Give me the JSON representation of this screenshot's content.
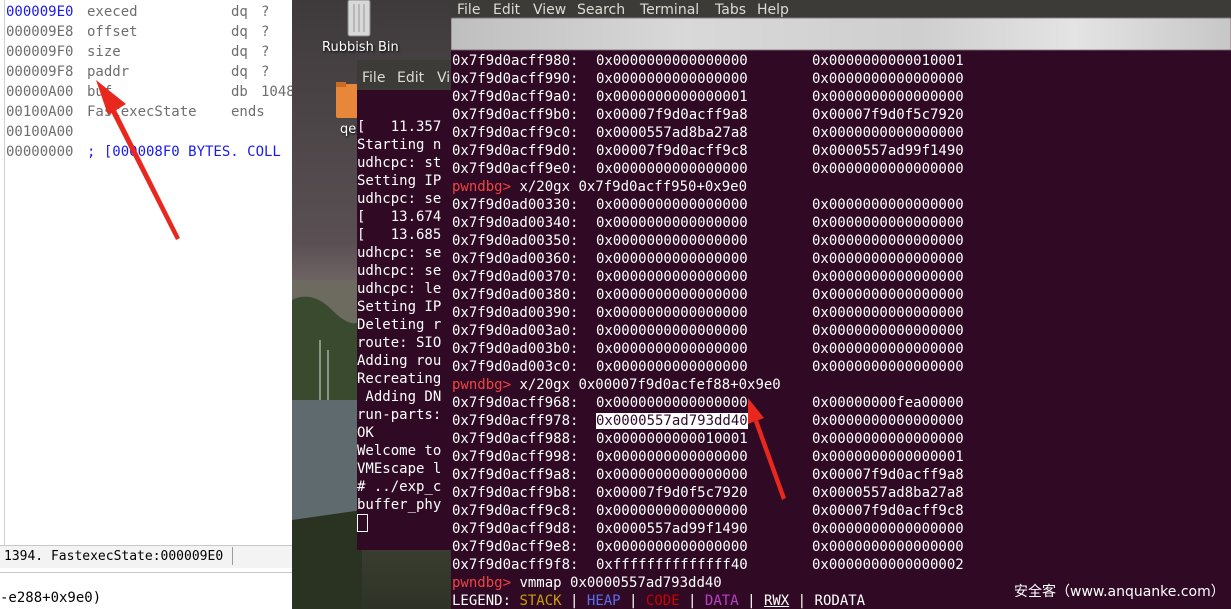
{
  "ida": {
    "rows": [
      {
        "addr": "000009E0",
        "name": "execed",
        "type": "dq",
        "value": "?",
        "highlight": true
      },
      {
        "addr": "000009E8",
        "name": "offset",
        "type": "dq",
        "value": "?"
      },
      {
        "addr": "000009F0",
        "name": "size",
        "type": "dq",
        "value": "?"
      },
      {
        "addr": "000009F8",
        "name": "paddr",
        "type": "dq",
        "value": "?"
      },
      {
        "addr": "00000A00",
        "name": "buf",
        "type": "db",
        "value": "1048"
      },
      {
        "addr": "00100A00",
        "name": "FastexecState",
        "type": "ends",
        "value": ""
      },
      {
        "addr": "00100A00",
        "name": "",
        "type": "",
        "value": ""
      },
      {
        "addr": "00000000",
        "name": "; [000008F0 BYTES. COLL",
        "type": "",
        "value": "",
        "comment": true
      }
    ],
    "status": "1394. FastexecState:000009E0",
    "output_line": "-e288+0x9e0)"
  },
  "desktop": {
    "trash_label": "Rubbish Bin",
    "folder_label": "qe"
  },
  "term2": {
    "menu": [
      "File",
      "Edit",
      "Vi"
    ],
    "lines": [
      "[   11.357",
      "Starting n",
      "udhcpc: st",
      "Setting IP",
      "udhcpc: se",
      "[   13.674",
      "[   13.685",
      "udhcpc: se",
      "udhcpc: se",
      "udhcpc: le",
      "Setting IP",
      "Deleting r",
      "route: SIO",
      "Adding rou",
      "Recreating",
      " Adding DN",
      "run-parts:",
      "OK",
      "",
      "Welcome to",
      "VMEscape l",
      "# ../exp_c",
      "buffer_phy"
    ]
  },
  "term": {
    "menu": [
      "File",
      "Edit",
      "View",
      "Search",
      "Terminal",
      "Tabs",
      "Help"
    ],
    "lines": [
      {
        "kind": "mem",
        "addr": "0x7f9d0acff980:",
        "v1": "0x0000000000000000",
        "v2": "0x0000000000010001"
      },
      {
        "kind": "mem",
        "addr": "0x7f9d0acff990:",
        "v1": "0x0000000000000000",
        "v2": "0x0000000000000000"
      },
      {
        "kind": "mem",
        "addr": "0x7f9d0acff9a0:",
        "v1": "0x0000000000000001",
        "v2": "0x0000000000000000"
      },
      {
        "kind": "mem",
        "addr": "0x7f9d0acff9b0:",
        "v1": "0x00007f9d0acff9a8",
        "v2": "0x00007f9d0f5c7920"
      },
      {
        "kind": "mem",
        "addr": "0x7f9d0acff9c0:",
        "v1": "0x0000557ad8ba27a8",
        "v2": "0x0000000000000000"
      },
      {
        "kind": "mem",
        "addr": "0x7f9d0acff9d0:",
        "v1": "0x00007f9d0acff9c8",
        "v2": "0x0000557ad99f1490"
      },
      {
        "kind": "mem",
        "addr": "0x7f9d0acff9e0:",
        "v1": "0x0000000000000000",
        "v2": "0x0000000000000000"
      },
      {
        "kind": "cmd",
        "prompt": "pwndbg>",
        "cmd": " x/20gx 0x7f9d0acff950+0x9e0"
      },
      {
        "kind": "mem",
        "addr": "0x7f9d0ad00330:",
        "v1": "0x0000000000000000",
        "v2": "0x0000000000000000"
      },
      {
        "kind": "mem",
        "addr": "0x7f9d0ad00340:",
        "v1": "0x0000000000000000",
        "v2": "0x0000000000000000"
      },
      {
        "kind": "mem",
        "addr": "0x7f9d0ad00350:",
        "v1": "0x0000000000000000",
        "v2": "0x0000000000000000"
      },
      {
        "kind": "mem",
        "addr": "0x7f9d0ad00360:",
        "v1": "0x0000000000000000",
        "v2": "0x0000000000000000"
      },
      {
        "kind": "mem",
        "addr": "0x7f9d0ad00370:",
        "v1": "0x0000000000000000",
        "v2": "0x0000000000000000"
      },
      {
        "kind": "mem",
        "addr": "0x7f9d0ad00380:",
        "v1": "0x0000000000000000",
        "v2": "0x0000000000000000"
      },
      {
        "kind": "mem",
        "addr": "0x7f9d0ad00390:",
        "v1": "0x0000000000000000",
        "v2": "0x0000000000000000"
      },
      {
        "kind": "mem",
        "addr": "0x7f9d0ad003a0:",
        "v1": "0x0000000000000000",
        "v2": "0x0000000000000000"
      },
      {
        "kind": "mem",
        "addr": "0x7f9d0ad003b0:",
        "v1": "0x0000000000000000",
        "v2": "0x0000000000000000"
      },
      {
        "kind": "mem",
        "addr": "0x7f9d0ad003c0:",
        "v1": "0x0000000000000000",
        "v2": "0x0000000000000000"
      },
      {
        "kind": "cmd",
        "prompt": "pwndbg>",
        "cmd": " x/20gx 0x00007f9d0acfef88+0x9e0"
      },
      {
        "kind": "mem",
        "addr": "0x7f9d0acff968:",
        "v1": "0x0000000000000000",
        "v2": "0x00000000fea00000"
      },
      {
        "kind": "mem",
        "addr": "0x7f9d0acff978:",
        "v1": "0x0000557ad793dd40",
        "v2": "0x0000000000000000",
        "selected": true
      },
      {
        "kind": "mem",
        "addr": "0x7f9d0acff988:",
        "v1": "0x0000000000010001",
        "v2": "0x0000000000000000"
      },
      {
        "kind": "mem",
        "addr": "0x7f9d0acff998:",
        "v1": "0x0000000000000000",
        "v2": "0x0000000000000001"
      },
      {
        "kind": "mem",
        "addr": "0x7f9d0acff9a8:",
        "v1": "0x0000000000000000",
        "v2": "0x00007f9d0acff9a8"
      },
      {
        "kind": "mem",
        "addr": "0x7f9d0acff9b8:",
        "v1": "0x00007f9d0f5c7920",
        "v2": "0x0000557ad8ba27a8"
      },
      {
        "kind": "mem",
        "addr": "0x7f9d0acff9c8:",
        "v1": "0x0000000000000000",
        "v2": "0x00007f9d0acff9c8"
      },
      {
        "kind": "mem",
        "addr": "0x7f9d0acff9d8:",
        "v1": "0x0000557ad99f1490",
        "v2": "0x0000000000000000"
      },
      {
        "kind": "mem",
        "addr": "0x7f9d0acff9e8:",
        "v1": "0x0000000000000000",
        "v2": "0x0000000000000000"
      },
      {
        "kind": "mem",
        "addr": "0x7f9d0acff9f8:",
        "v1": "0xffffffffffffff40",
        "v2": "0x0000000000000002"
      },
      {
        "kind": "cmd",
        "prompt": "pwndbg>",
        "cmd": " vmmap 0x0000557ad793dd40"
      }
    ],
    "legend": {
      "prefix": "LEGEND: ",
      "items": [
        "STACK",
        "HEAP",
        "CODE",
        "DATA",
        "RWX",
        "RODATA"
      ],
      "sep": " | "
    },
    "watermark": "安全客（www.anquanke.com）"
  },
  "colors": {
    "terminal_bg": "#300a24",
    "prompt": "#ee4444",
    "ida_highlight": "#1a1aee",
    "arrow": "#e8281e"
  }
}
